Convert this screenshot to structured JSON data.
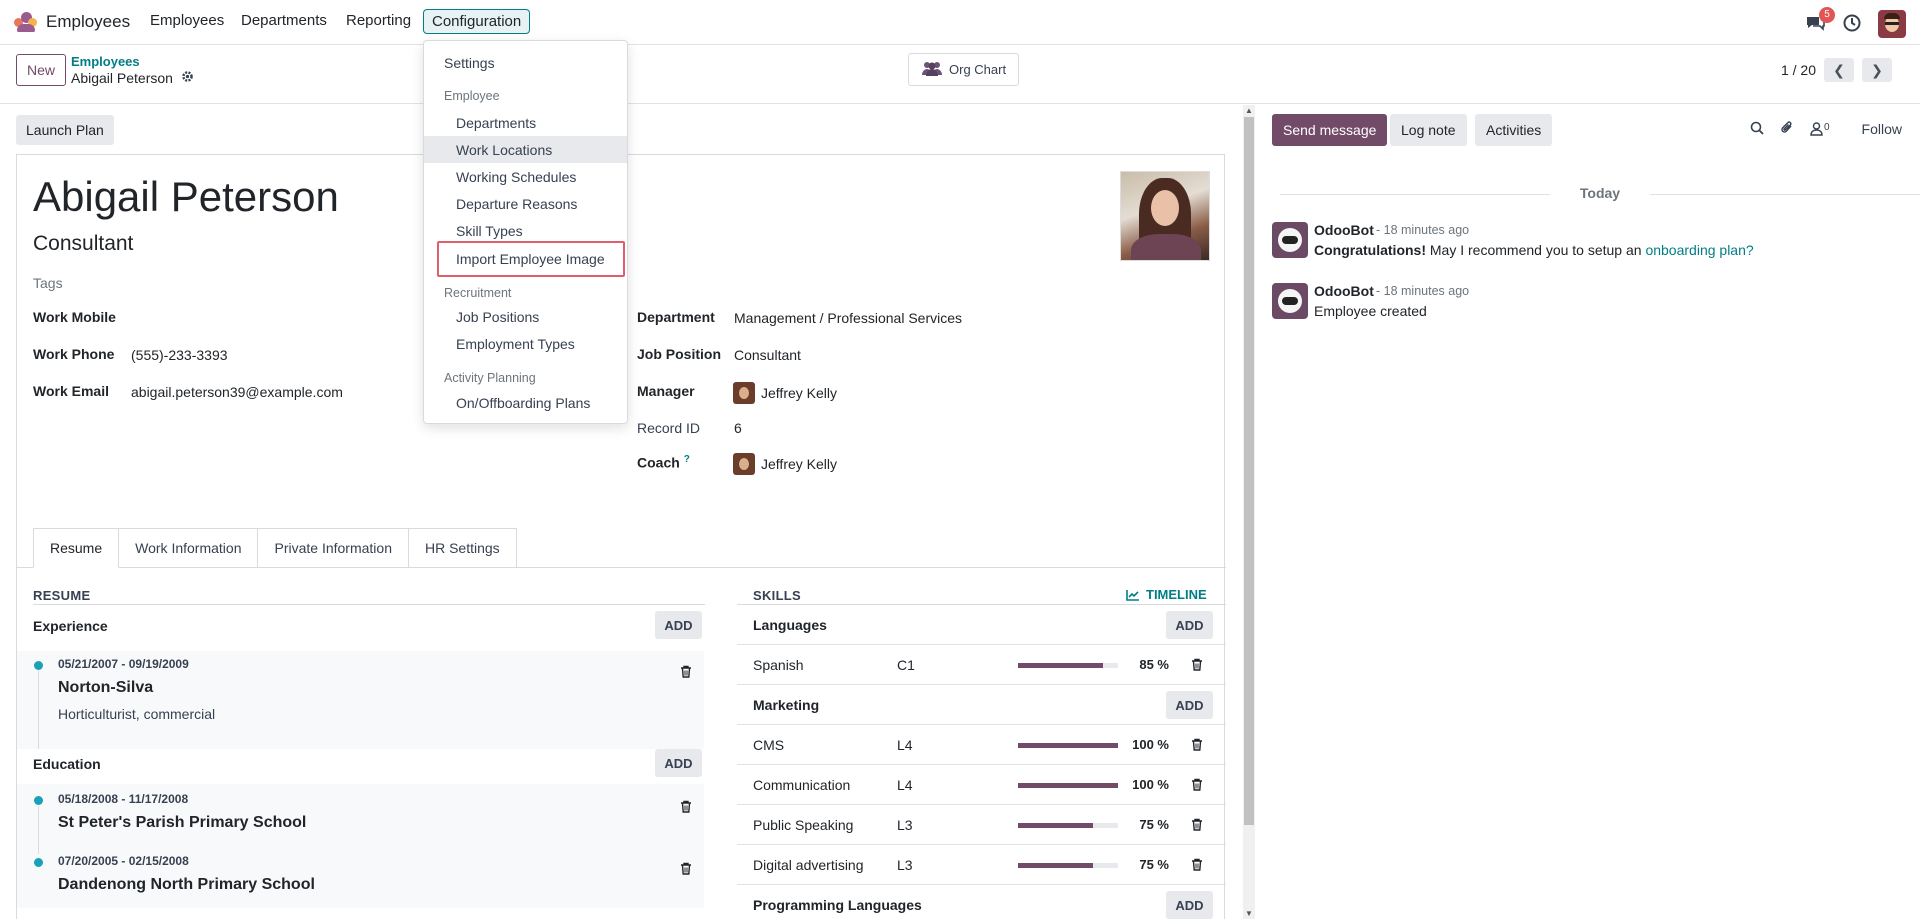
{
  "nav": {
    "app_name": "Employees",
    "menus": [
      "Employees",
      "Departments",
      "Reporting",
      "Configuration"
    ],
    "chat_badge": "5"
  },
  "control": {
    "new_label": "New",
    "breadcrumb_parent": "Employees",
    "breadcrumb_current": "Abigail Peterson",
    "org_chart_label": "Org Chart",
    "pager": "1 / 20"
  },
  "form": {
    "launch_plan_label": "Launch Plan",
    "name": "Abigail Peterson",
    "job_title": "Consultant",
    "tags_placeholder": "Tags",
    "left_fields": [
      {
        "label": "Work Mobile",
        "value": ""
      },
      {
        "label": "Work Phone",
        "value": "(555)-233-3393"
      },
      {
        "label": "Work Email",
        "value": "abigail.peterson39@example.com"
      }
    ],
    "right_fields": [
      {
        "label": "Department",
        "value": "Management / Professional Services"
      },
      {
        "label": "Job Position",
        "value": "Consultant"
      },
      {
        "label": "Manager",
        "value": "Jeffrey Kelly"
      },
      {
        "label": "Record ID",
        "value": "6"
      },
      {
        "label": "Coach",
        "value": "Jeffrey Kelly",
        "help": "?"
      }
    ],
    "tabs": [
      "Resume",
      "Work Information",
      "Private Information",
      "HR Settings"
    ]
  },
  "resume": {
    "title": "RESUME",
    "add_label": "ADD",
    "experience_title": "Experience",
    "experience": [
      {
        "dates": "05/21/2007 - 09/19/2009",
        "name": "Norton-Silva",
        "desc": "Horticulturist, commercial"
      }
    ],
    "education_title": "Education",
    "education": [
      {
        "dates": "05/18/2008 - 11/17/2008",
        "name": "St Peter's Parish Primary School"
      },
      {
        "dates": "07/20/2005 - 02/15/2008",
        "name": "Dandenong North Primary School"
      }
    ]
  },
  "skills": {
    "title": "SKILLS",
    "timeline_label": "TIMELINE",
    "add_label": "ADD",
    "groups": [
      {
        "name": "Languages",
        "items": [
          {
            "name": "Spanish",
            "level": "C1",
            "progress": 85,
            "pct": "85 %"
          }
        ]
      },
      {
        "name": "Marketing",
        "items": [
          {
            "name": "CMS",
            "level": "L4",
            "progress": 100,
            "pct": "100 %"
          },
          {
            "name": "Communication",
            "level": "L4",
            "progress": 100,
            "pct": "100 %"
          },
          {
            "name": "Public Speaking",
            "level": "L3",
            "progress": 75,
            "pct": "75 %"
          },
          {
            "name": "Digital advertising",
            "level": "L3",
            "progress": 75,
            "pct": "75 %"
          }
        ]
      },
      {
        "name": "Programming Languages",
        "items": []
      }
    ]
  },
  "dropdown": {
    "settings": "Settings",
    "employee_header": "Employee",
    "employee_items": [
      "Departments",
      "Work Locations",
      "Working Schedules",
      "Departure Reasons",
      "Skill Types",
      "Import Employee Image"
    ],
    "recruitment_header": "Recruitment",
    "recruitment_items": [
      "Job Positions",
      "Employment Types"
    ],
    "activity_header": "Activity Planning",
    "activity_items": [
      "On/Offboarding Plans"
    ]
  },
  "chatter": {
    "send_message": "Send message",
    "log_note": "Log note",
    "activities": "Activities",
    "followers_count": "0",
    "follow": "Follow",
    "today": "Today",
    "messages": [
      {
        "author": "OdooBot",
        "time": "- 18 minutes ago",
        "bold": "Congratulations!",
        "text": " May I recommend you to setup an ",
        "link": "onboarding plan?"
      },
      {
        "author": "OdooBot",
        "time": "- 18 minutes ago",
        "bold": "",
        "text": "Employee created",
        "link": ""
      }
    ]
  },
  "colors": {
    "brand": "#714b67",
    "accent": "#017e84",
    "highlight": "#e05d6a",
    "dot": "#17a2b8"
  }
}
